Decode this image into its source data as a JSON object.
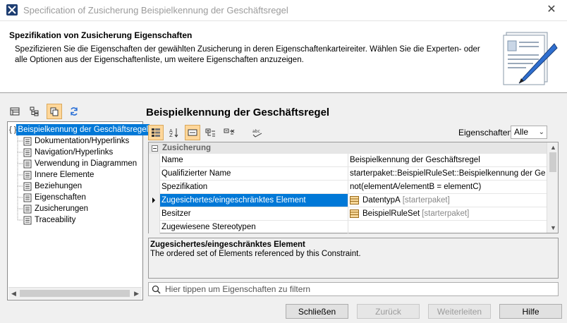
{
  "window": {
    "title": "Specification of Zusicherung Beispielkennung der Geschäftsregel",
    "close_glyph": "✕"
  },
  "header": {
    "title": "Spezifikation von Zusicherung Eigenschaften",
    "description": "Spezifizieren Sie die Eigenschaften der gewählten Zusicherung in deren Eigenschaftenkarteireiter. Wählen Sie die Experten- oder alle Optionen aus der Eigenschaftenliste, um weitere Eigenschaften anzuzeigen."
  },
  "tree": {
    "root_brace": "{ }",
    "root_label": "Beispielkennung der Geschäftsregel",
    "items": [
      {
        "label": "Dokumentation/Hyperlinks"
      },
      {
        "label": "Navigation/Hyperlinks"
      },
      {
        "label": "Verwendung in Diagrammen"
      },
      {
        "label": "Innere Elemente"
      },
      {
        "label": "Beziehungen"
      },
      {
        "label": "Eigenschaften"
      },
      {
        "label": "Zusicherungen"
      },
      {
        "label": "Traceability"
      }
    ]
  },
  "panel": {
    "title": "Beispielkennung der Geschäftsregel",
    "properties_label": "Eigenschaften:",
    "properties_value": "Alle"
  },
  "grid": {
    "group": "Zusicherung",
    "rows": [
      {
        "name": "Name",
        "value": "Beispielkennung der Geschäftsregel"
      },
      {
        "name": "Qualifizierter Name",
        "value": "starterpaket::BeispielRuleSet::Beispielkennung der Geschä"
      },
      {
        "name": "Spezifikation",
        "value": "not(elementA/elementB = elementC)"
      },
      {
        "name": "Zugesichertes/eingeschränktes Element",
        "value": "DatentypA",
        "owner": "[starterpaket]"
      },
      {
        "name": "Besitzer",
        "value": "BeispielRuleSet",
        "owner": "[starterpaket]"
      },
      {
        "name": "Zugewiesene Stereotypen",
        "value": ""
      }
    ]
  },
  "description": {
    "title": "Zugesichertes/eingeschränktes Element",
    "text": "The ordered set of Elements referenced by this Constraint."
  },
  "filter": {
    "placeholder": "Hier tippen um Eigenschaften zu filtern"
  },
  "buttons": {
    "close": "Schließen",
    "back": "Zurück",
    "forward": "Weiterleiten",
    "help": "Hilfe"
  },
  "colors": {
    "selection": "#0078d7",
    "active_tool": "#ffd79a"
  }
}
